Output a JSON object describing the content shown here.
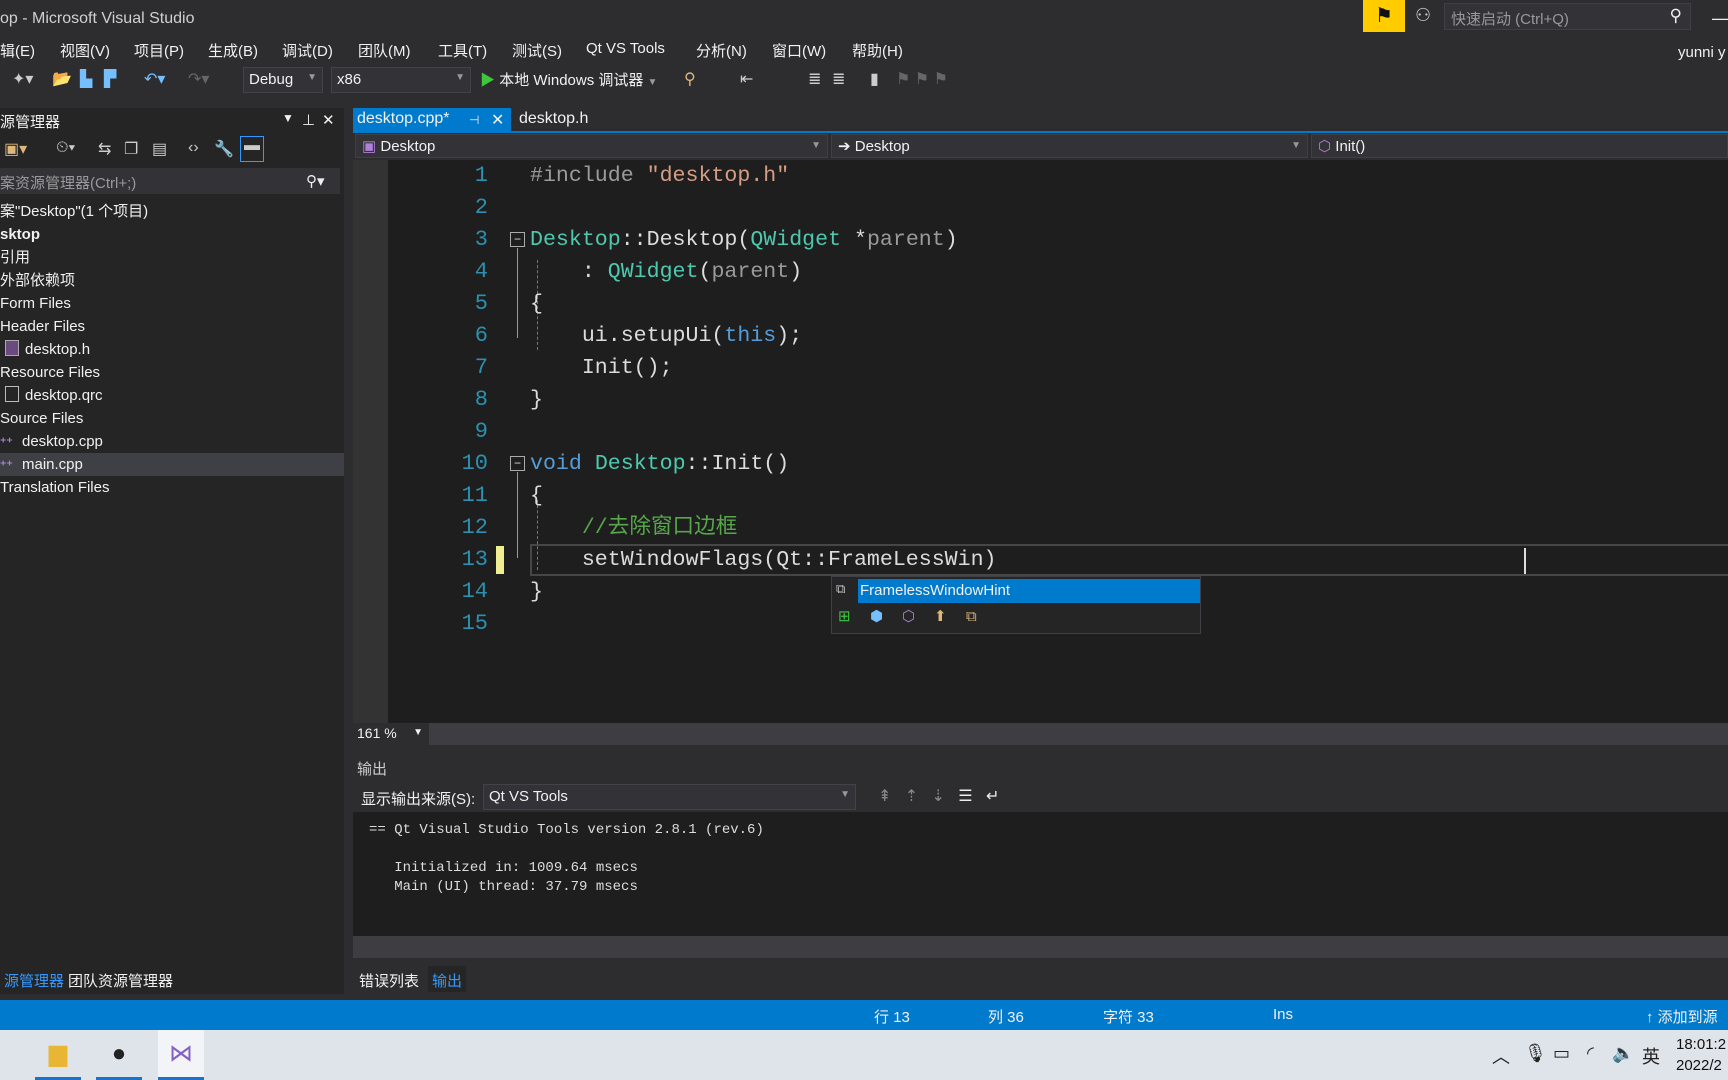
{
  "window": {
    "title": "op - Microsoft Visual Studio",
    "quick_launch_placeholder": "快速启动 (Ctrl+Q)",
    "user": "yunni y"
  },
  "menu": [
    "辑(E)",
    "视图(V)",
    "项目(P)",
    "生成(B)",
    "调试(D)",
    "团队(M)",
    "工具(T)",
    "测试(S)",
    "Qt VS Tools",
    "分析(N)",
    "窗口(W)",
    "帮助(H)"
  ],
  "toolbar": {
    "config": "Debug",
    "platform": "x86",
    "run_label": "本地 Windows 调试器"
  },
  "solution_explorer": {
    "title": "源管理器",
    "search_placeholder": "案资源管理器(Ctrl+;)",
    "items": [
      {
        "label": "案\"Desktop\"(1 个项目)",
        "bold": false
      },
      {
        "label": "sktop",
        "bold": true
      },
      {
        "label": "引用"
      },
      {
        "label": "外部依赖项"
      },
      {
        "label": "Form Files"
      },
      {
        "label": "Header Files"
      },
      {
        "label": "desktop.h",
        "icon": "header-file-icon"
      },
      {
        "label": "Resource Files"
      },
      {
        "label": "desktop.qrc",
        "icon": "file-icon"
      },
      {
        "label": "Source Files"
      },
      {
        "label": "desktop.cpp",
        "icon": "cpp-file-icon"
      },
      {
        "label": "main.cpp",
        "icon": "cpp-file-icon",
        "selected": true
      },
      {
        "label": "Translation Files"
      }
    ]
  },
  "editor": {
    "tabs": [
      {
        "label": "desktop.cpp*",
        "active": true
      },
      {
        "label": "desktop.h"
      }
    ],
    "nav": {
      "project": "Desktop",
      "scope": "Desktop",
      "member": "Init()"
    },
    "lines": [
      [
        [
          "pre",
          "#include "
        ],
        [
          "str",
          "\"desktop.h\""
        ]
      ],
      [],
      [
        [
          "type",
          "Desktop"
        ],
        [
          "plain",
          "::Desktop("
        ],
        [
          "type",
          "QWidget"
        ],
        [
          "plain",
          " *"
        ],
        [
          "param",
          "parent"
        ],
        [
          "plain",
          ")"
        ]
      ],
      [
        [
          "plain",
          "    : "
        ],
        [
          "type",
          "QWidget"
        ],
        [
          "plain",
          "("
        ],
        [
          "param",
          "parent"
        ],
        [
          "plain",
          ")"
        ]
      ],
      [
        [
          "plain",
          "{"
        ]
      ],
      [
        [
          "plain",
          "    ui.setupUi("
        ],
        [
          "kw",
          "this"
        ],
        [
          "plain",
          ");"
        ]
      ],
      [
        [
          "plain",
          "    Init();"
        ]
      ],
      [
        [
          "plain",
          "}"
        ]
      ],
      [],
      [
        [
          "kw",
          "void"
        ],
        [
          "plain",
          " "
        ],
        [
          "type",
          "Desktop"
        ],
        [
          "plain",
          "::Init()"
        ]
      ],
      [
        [
          "plain",
          "{"
        ]
      ],
      [
        [
          "cm",
          "    //去除窗口边框"
        ]
      ],
      [
        [
          "plain",
          "    setWindowFlags(Qt::FrameLessWin)"
        ]
      ],
      [
        [
          "plain",
          "}"
        ]
      ],
      []
    ],
    "autocomplete": "FramelessWindowHint",
    "zoom": "161 %",
    "cursor": {
      "line": 13,
      "col": 36,
      "char": 33
    }
  },
  "output": {
    "title": "输出",
    "source_label": "显示输出来源(S):",
    "source": "Qt VS Tools",
    "lines": [
      "== Qt Visual Studio Tools version 2.8.1 (rev.6)",
      "",
      "   Initialized in: 1009.64 msecs",
      "   Main (UI) thread: 37.79 msecs"
    ]
  },
  "bottom_tabs": {
    "left": [
      "源管理器",
      "团队资源管理器"
    ],
    "right": [
      "错误列表",
      "输出"
    ]
  },
  "status": {
    "line": "行 13",
    "col": "列 36",
    "char": "字符 33",
    "mode": "Ins",
    "source_control": "添加到源"
  },
  "taskbar": {
    "ime": "英",
    "time": "18:01:2",
    "date": "2022/2"
  },
  "colors": {
    "accent": "#007acc",
    "feedback": "#ffcc00",
    "background": "#2d2d30",
    "editor": "#1e1e1e"
  }
}
